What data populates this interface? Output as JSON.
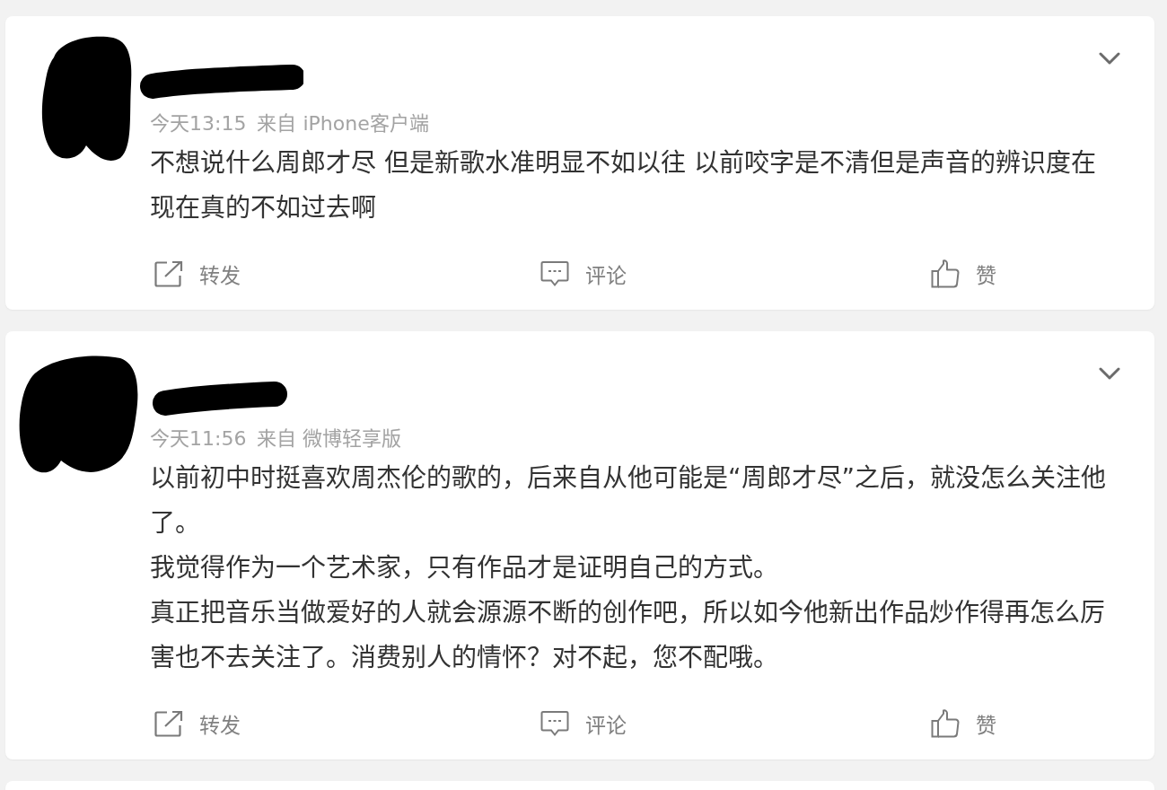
{
  "posts": [
    {
      "author_hidden": true,
      "time": "今天13:15",
      "source": "来自 iPhone客户端",
      "paragraphs": [
        "不想说什么周郎才尽 但是新歌水准明显不如以往 以前咬字是不清但是声音的辨识度在现在真的不如过去啊"
      ],
      "actions": [
        {
          "kind": "repost",
          "label": "转发"
        },
        {
          "kind": "comment",
          "label": "评论"
        },
        {
          "kind": "like",
          "label": "赞"
        }
      ]
    },
    {
      "author_hidden": true,
      "time": "今天11:56",
      "source": "来自 微博轻享版",
      "paragraphs": [
        "以前初中时挺喜欢周杰伦的歌的，后来自从他可能是“周郎才尽”之后，就没怎么关注他了。",
        "我觉得作为一个艺术家，只有作品才是证明自己的方式。",
        "真正把音乐当做爱好的人就会源源不断的创作吧，所以如今他新出作品炒作得再怎么厉害也不去关注了。消费别人的情怀？对不起，您不配哦。"
      ],
      "actions": [
        {
          "kind": "repost",
          "label": "转发"
        },
        {
          "kind": "comment",
          "label": "评论"
        },
        {
          "kind": "like",
          "label": "赞"
        }
      ]
    }
  ]
}
